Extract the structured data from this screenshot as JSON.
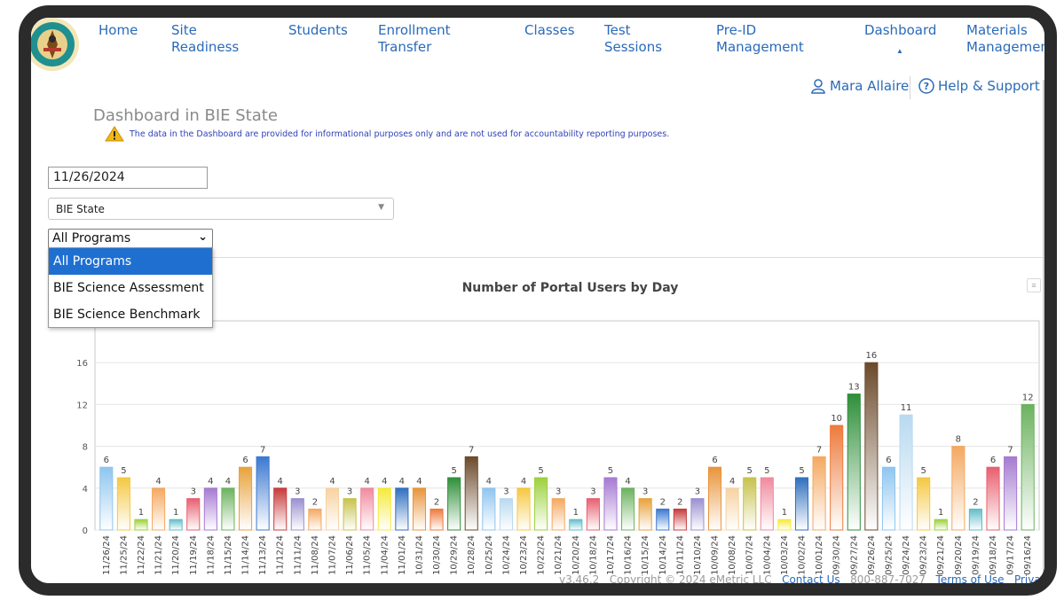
{
  "nav": {
    "items": [
      "Home",
      "Site\nReadiness",
      "Students",
      "Enrollment\nTransfer",
      "Classes",
      "Test\nSessions",
      "Pre-ID\nManagement",
      "Dashboard",
      "Materials\nManagement"
    ]
  },
  "user": {
    "name": "Mara Allaire",
    "help_label": "Help & Support"
  },
  "page": {
    "title": "Dashboard in BIE State",
    "warning": "The data in the Dashboard are provided for informational purposes only and are not used for accountability reporting purposes."
  },
  "filters": {
    "date_value": "11/26/2024",
    "state_value": "BIE State",
    "program_value": "All Programs",
    "program_options": [
      "All Programs",
      "BIE Science Assessment",
      "BIE Science Benchmark"
    ]
  },
  "colors": {
    "link": "#2a6ab8",
    "selected_option": "#1f6fd1",
    "warning_icon": "#f2b718",
    "bars": [
      "#8ec5ef",
      "#f5c842",
      "#9cd13b",
      "#f4a860",
      "#5fbec9",
      "#e85f6f",
      "#a57ad1",
      "#6cb25f",
      "#e8a23c",
      "#3b78d1",
      "#c73b3b",
      "#9a8fd0",
      "#d68b3b",
      "#f7d2a0",
      "#c7c24c",
      "#f08a9e",
      "#f5ea3b",
      "#2f6fbf",
      "#e8943b",
      "#2f8f3a",
      "#6b4a2b",
      "#b8d9f0",
      "#ee7a3b"
    ]
  },
  "chart_data": {
    "type": "bar",
    "title": "Number of Portal Users by Day",
    "categories": [
      "11/26/24",
      "11/25/24",
      "11/22/24",
      "11/21/24",
      "11/20/24",
      "11/19/24",
      "11/18/24",
      "11/15/24",
      "11/14/24",
      "11/13/24",
      "11/12/24",
      "11/11/24",
      "11/08/24",
      "11/07/24",
      "11/06/24",
      "11/05/24",
      "11/04/24",
      "11/01/24",
      "10/31/24",
      "10/30/24",
      "10/29/24",
      "10/28/24",
      "10/25/24",
      "10/24/24",
      "10/23/24",
      "10/22/24",
      "10/21/24",
      "10/20/24",
      "10/18/24",
      "10/17/24",
      "10/16/24",
      "10/15/24",
      "10/14/24",
      "10/11/24",
      "10/10/24",
      "10/09/24",
      "10/08/24",
      "10/07/24",
      "10/04/24",
      "10/03/24",
      "10/02/24",
      "10/01/24",
      "09/30/24",
      "09/27/24",
      "09/26/24",
      "09/25/24",
      "09/24/24",
      "09/23/24",
      "09/21/24",
      "09/20/24",
      "09/19/24",
      "09/18/24",
      "09/17/24",
      "09/16/24"
    ],
    "values": [
      6,
      5,
      1,
      4,
      1,
      3,
      4,
      4,
      6,
      7,
      4,
      3,
      2,
      4,
      3,
      4,
      4,
      4,
      4,
      2,
      5,
      7,
      4,
      3,
      4,
      5,
      3,
      1,
      3,
      5,
      4,
      3,
      2,
      2,
      3,
      6,
      4,
      5,
      5,
      1,
      5,
      7,
      10,
      13,
      16,
      6,
      11,
      5,
      1,
      8,
      2,
      6,
      7,
      12
    ],
    "yticks": [
      0,
      4,
      8,
      12,
      16
    ],
    "ylim": [
      0,
      20
    ],
    "grid": true,
    "bar_colors": [
      "#8ec5ef",
      "#f5c842",
      "#9cd13b",
      "#f4a860",
      "#5fbec9",
      "#e85f6f",
      "#a57ad1",
      "#6cb25f",
      "#e8a23c",
      "#3b78d1",
      "#c73b3b",
      "#9a8fd0",
      "#f4a860",
      "#f7d2a0",
      "#c7c24c",
      "#f08a9e",
      "#f5ea3b",
      "#2f6fbf",
      "#e8943b",
      "#ee7a3b",
      "#2f8f3a",
      "#6b4a2b",
      "#8ec5ef",
      "#b8d9f0",
      "#f5c842",
      "#9cd13b",
      "#f4a860",
      "#5fbec9",
      "#e85f6f",
      "#a57ad1",
      "#6cb25f",
      "#e8a23c",
      "#3b78d1",
      "#c73b3b",
      "#9a8fd0",
      "#e8943b",
      "#f7d2a0",
      "#c7c24c",
      "#f08a9e",
      "#f5ea3b",
      "#2f6fbf",
      "#f4a860",
      "#ee7a3b",
      "#2f8f3a",
      "#6b4a2b",
      "#8ec5ef",
      "#b8d9f0",
      "#f5c842",
      "#9cd13b",
      "#f4a860",
      "#5fbec9",
      "#e85f6f",
      "#a57ad1",
      "#6cb25f"
    ]
  },
  "footer": {
    "version": "v3.46.2",
    "copyright": "Copyright © 2024 eMetric LLC",
    "contact": "Contact Us",
    "phone": "800-887-7027",
    "terms": "Terms of Use",
    "privacy": "Privacy"
  },
  "icons": {
    "logo": "bie-seal-logo",
    "user": "user-icon",
    "help": "help-circle-icon",
    "warning": "warning-triangle-icon",
    "menu": "chart-menu-icon"
  }
}
